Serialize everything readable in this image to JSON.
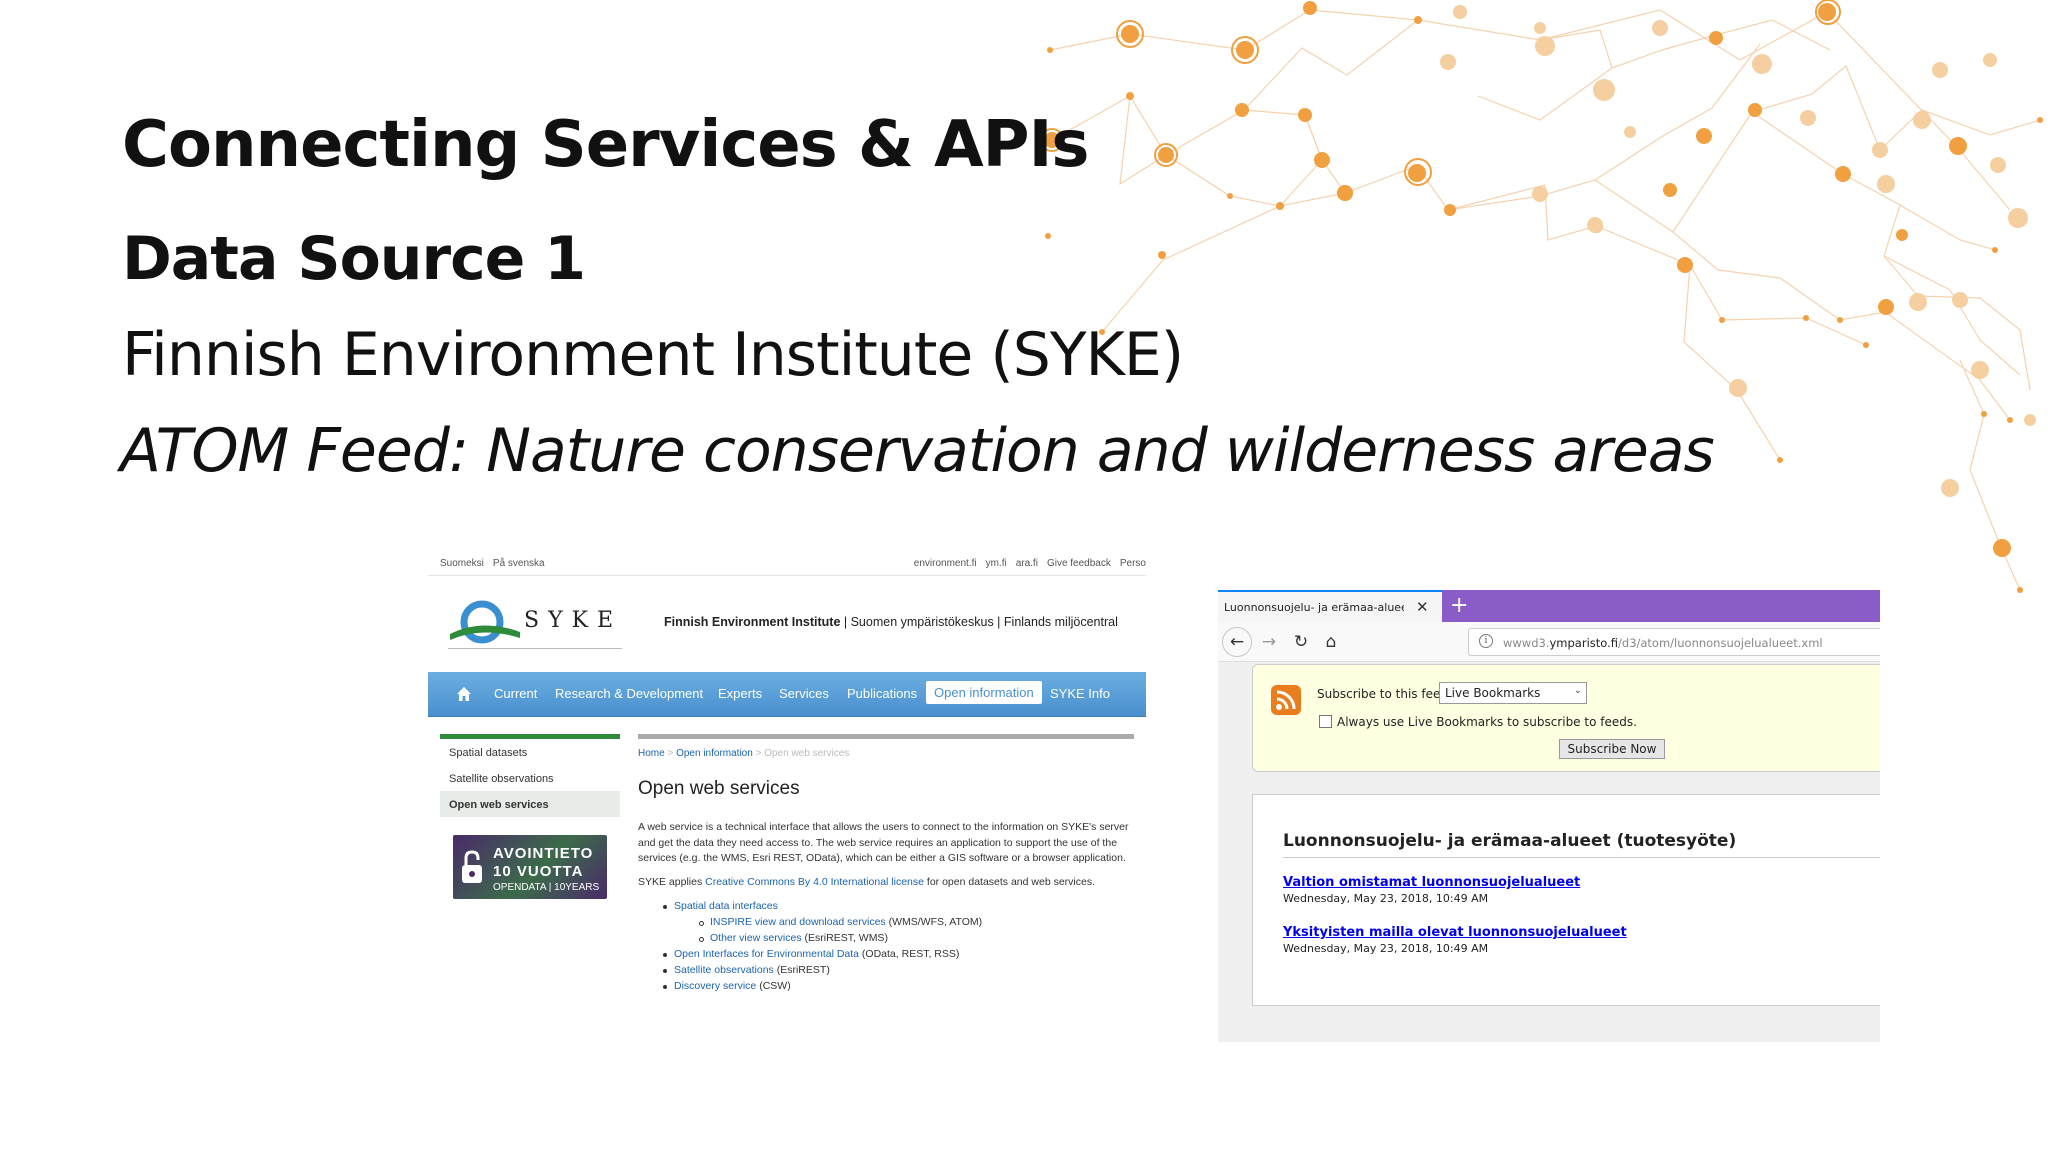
{
  "slide": {
    "title": "Connecting Services & APIs",
    "subtitle": "Data Source 1",
    "org": "Finnish Environment Institute (SYKE)",
    "feed": "ATOM Feed: Nature conservation and wilderness areas"
  },
  "syke": {
    "top_langs": [
      "Suomeksi",
      "På svenska"
    ],
    "top_links": [
      "environment.fi",
      "ym.fi",
      "ara.fi",
      "Give feedback",
      "Perso"
    ],
    "logo_text": "SYKE",
    "tagline_bold": "Finnish Environment Institute",
    "tagline_rest": " | Suomen ympäristökeskus | Finlands miljöcentral",
    "nav": [
      "Current",
      "Research & Development",
      "Experts",
      "Services",
      "Publications",
      "Open information",
      "SYKE Info"
    ],
    "nav_active": "Open information",
    "sidebar": [
      "Spatial datasets",
      "Satellite observations",
      "Open web services"
    ],
    "banner": {
      "line1": "AVOINTIETO",
      "line2": "10 VUOTTA",
      "line3": "OPENDATA | 10YEARS"
    },
    "breadcrumb": {
      "home": "Home",
      "sep": ">",
      "open_info": "Open information",
      "current": "Open web services"
    },
    "heading": "Open web services",
    "paragraph": "A web service is a technical interface that allows the users to connect to the information on SYKE's server and get the data they need access to. The web service requires an application to support the use of the services (e.g. the WMS, Esri REST, OData), which can be either a GIS software or a browser application.",
    "applies_pre": "SYKE applies ",
    "applies_link": "Creative Commons By 4.0 International license",
    "applies_post": " for open datasets and web services.",
    "list": [
      {
        "link": "Spatial data interfaces",
        "rest": ""
      },
      {
        "link": "INSPIRE view and download services",
        "rest": " (WMS/WFS, ATOM)"
      },
      {
        "link": "Other view services",
        "rest": " (EsriREST, WMS)"
      },
      {
        "link": "Open Interfaces for Environmental Data",
        "rest": " (OData, REST, RSS)"
      },
      {
        "link": "Satellite observations",
        "rest": " (EsriREST)"
      },
      {
        "link": "Discovery service",
        "rest": " (CSW)"
      }
    ]
  },
  "browser": {
    "tab_title": "Luonnonsuojelu- ja erämaa-alueet",
    "tab_close": "✕",
    "new_tab": "+",
    "url_prefix": "wwwd3.",
    "url_domain": "ymparisto.fi",
    "url_path": "/d3/atom/luonnonsuojelualueet.xml",
    "subscribe_using": "Subscribe to this feed using",
    "reader_option": "Live Bookmarks",
    "always_use": "Always use Live Bookmarks to subscribe to feeds.",
    "subscribe_button": "Subscribe Now",
    "feed_title": "Luonnonsuojelu- ja erämaa-alueet (tuotesyöte)",
    "entries": [
      {
        "title": "Valtion omistamat luonnonsuojelualueet",
        "date": "Wednesday, May 23, 2018, 10:49 AM"
      },
      {
        "title": "Yksityisten mailla olevat luonnonsuojelualueet",
        "date": "Wednesday, May 23, 2018, 10:49 AM"
      }
    ]
  },
  "colors": {
    "accent_orange": "#f0a040",
    "syke_nav_blue": "#4a90cf",
    "syke_green": "#2e8b3a",
    "firefox_purple": "#8a5cc7",
    "feed_yellow": "#ffffe1",
    "link_blue": "#0000ee"
  },
  "icons": [
    "network-graphic",
    "home-icon",
    "lock-icon",
    "back-arrow-icon",
    "forward-arrow-icon",
    "reload-icon",
    "home-icon",
    "info-icon",
    "feed-icon",
    "chevron-down-icon"
  ]
}
